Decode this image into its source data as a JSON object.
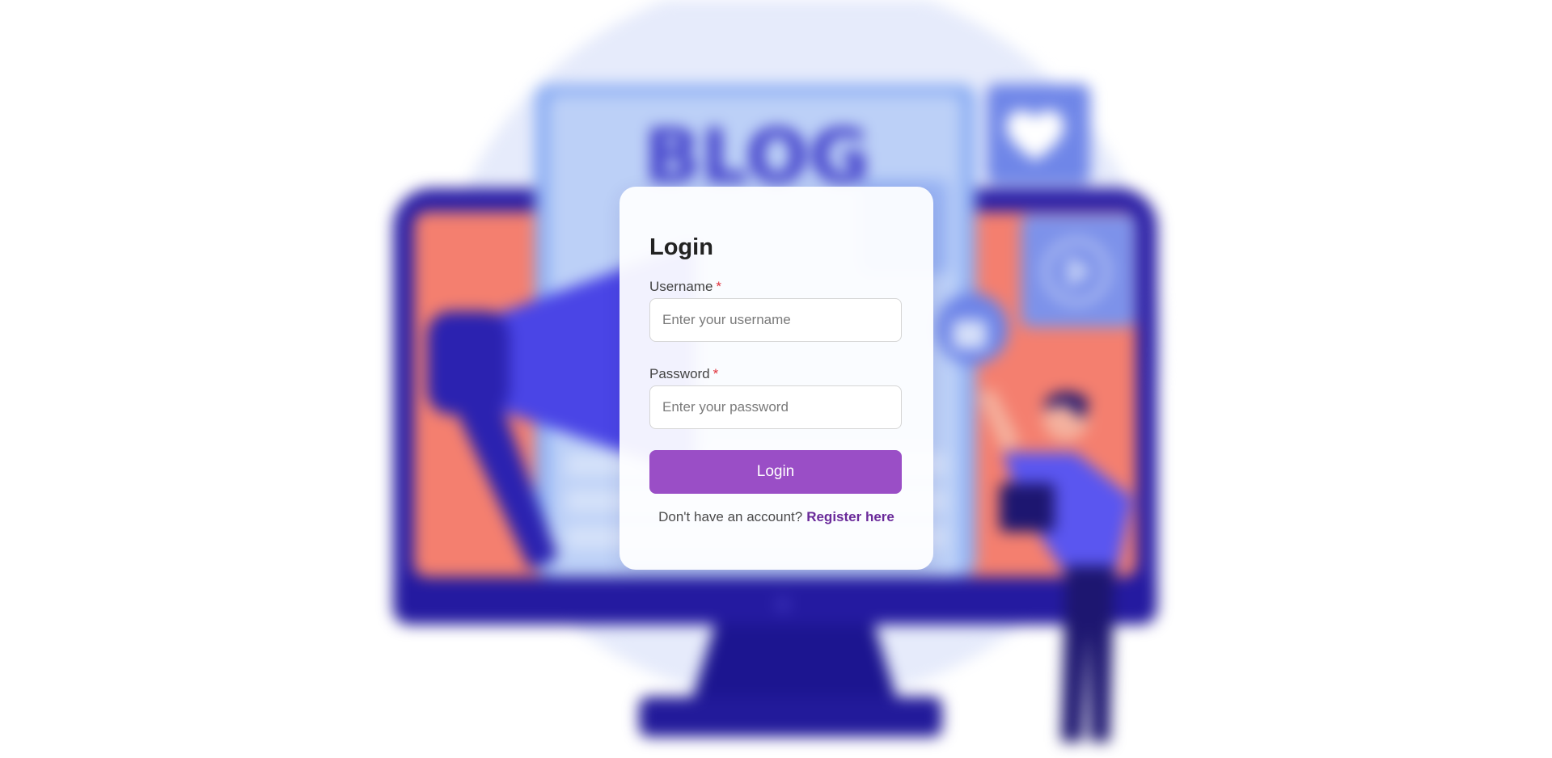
{
  "login": {
    "title": "Login",
    "username_label": "Username",
    "username_required": "*",
    "username_placeholder": "Enter your username",
    "username_value": "",
    "password_label": "Password",
    "password_required": "*",
    "password_placeholder": "Enter your password",
    "password_value": "",
    "submit_label": "Login",
    "register_prompt": "Don't have an account?",
    "register_link": "Register here"
  },
  "background": {
    "sign_text": "BLOG"
  },
  "colors": {
    "accent": "#9a4ec6",
    "link": "#6a2a9a",
    "required": "#e0303a"
  }
}
